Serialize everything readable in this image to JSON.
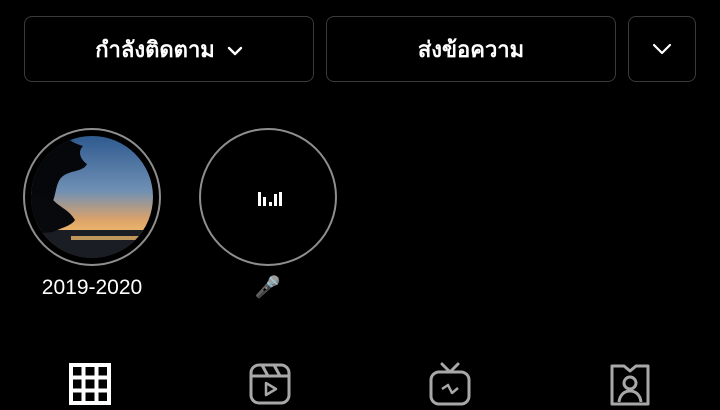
{
  "actions": {
    "following_label": "กำลังติดตาม",
    "message_label": "ส่งข้อความ"
  },
  "highlights": [
    {
      "title": "2019-2020"
    },
    {
      "title": "🎤"
    }
  ],
  "icons": {
    "following_chevron": "chevron-down-icon",
    "more": "chevron-down-icon",
    "highlight2_cover": "audio-bars-icon",
    "tabs": [
      "grid-icon",
      "reels-icon",
      "igtv-icon",
      "tagged-icon"
    ]
  }
}
